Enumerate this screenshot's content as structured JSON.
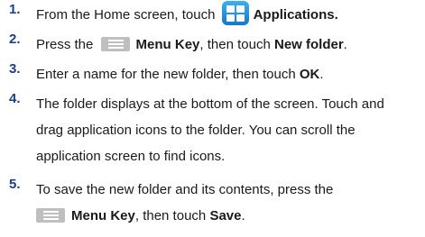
{
  "steps": [
    {
      "number": "1.",
      "pre": "From the Home screen, touch",
      "icon": "applications-grid-icon",
      "bold": "Applications."
    },
    {
      "number": "2.",
      "pre": "Press the",
      "icon": "menu-key-icon",
      "bold1": "Menu Key",
      "mid": ", then touch",
      "bold2": "New folder",
      "post": "."
    },
    {
      "number": "3.",
      "pre": "Enter a name for the new folder, then touch",
      "bold": "OK",
      "post": "."
    },
    {
      "number": "4.",
      "lines": [
        "The folder displays at the bottom of the screen. Touch and",
        "drag application icons to the folder. You can scroll the",
        "application screen to find icons."
      ]
    },
    {
      "number": "5.",
      "line1": "To save the new folder and its contents, press the",
      "icon": "menu-key-icon",
      "bold1": "Menu Key",
      "mid": ", then touch",
      "bold2": "Save",
      "post": "."
    }
  ],
  "colors": {
    "number": "#1a3f8f",
    "text": "#1a1a1a",
    "apps_icon": "#1e8ddc",
    "menu_icon": "#bfbfbf"
  }
}
